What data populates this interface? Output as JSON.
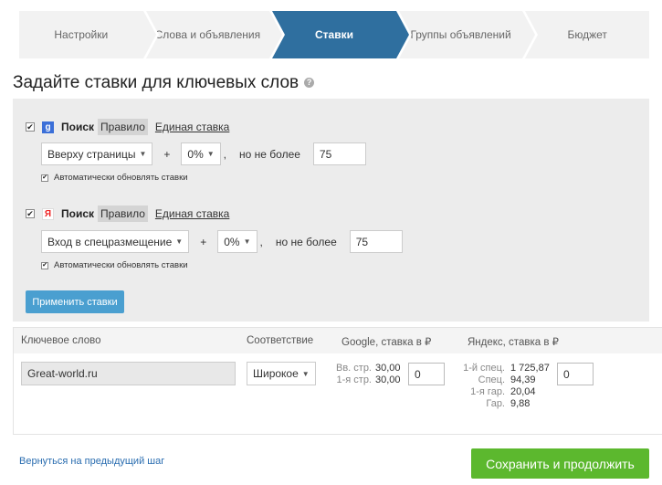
{
  "steps": [
    {
      "label": "Настройки",
      "active": false
    },
    {
      "label": "Слова и объявления",
      "active": false
    },
    {
      "label": "Ставки",
      "active": true
    },
    {
      "label": "Группы объявлений",
      "active": false
    },
    {
      "label": "Бюджет",
      "active": false
    }
  ],
  "page_title": "Задайте ставки для ключевых слов",
  "help_icon": "?",
  "google_block": {
    "logo": "g",
    "label": "Поиск",
    "tab_rule": "Правило",
    "tab_single": "Единая ставка",
    "position_select": "Вверху страницы",
    "plus": "+",
    "percent_select": "0%",
    "comma": ",",
    "max_label": "но не более",
    "max_value": "75",
    "auto_update": "Автоматически обновлять ставки"
  },
  "yandex_block": {
    "logo": "Я",
    "label": "Поиск",
    "tab_rule": "Правило",
    "tab_single": "Единая ставка",
    "position_select": "Вход в спецразмещение",
    "plus": "+",
    "percent_select": "0%",
    "comma": ",",
    "max_label": "но не более",
    "max_value": "75",
    "auto_update": "Автоматически обновлять ставки"
  },
  "apply_button": "Применить ставки",
  "table": {
    "headers": {
      "keyword": "Ключевое слово",
      "match": "Соответствие",
      "google": "Google, ставка в ₽",
      "yandex": "Яндекс, ставка в ₽"
    },
    "row": {
      "keyword": "Great-world.ru",
      "match": "Широкое",
      "google_labels": [
        "Вв. стр.",
        "1-я стр."
      ],
      "google_values": [
        "30,00",
        "30,00"
      ],
      "google_bid": "0",
      "yandex_labels": [
        "1-й спец.",
        "Спец.",
        "1-я гар.",
        "Гар."
      ],
      "yandex_values": [
        "1 725,87",
        "94,39",
        "20,04",
        "9,88"
      ],
      "yandex_bid": "0"
    }
  },
  "back_link": "Вернуться на предыдущий шаг",
  "save_button": "Сохранить и продолжить",
  "colors": {
    "active_step": "#2f6f9f",
    "apply_button": "#4a9fd0",
    "save_button": "#5cb82e",
    "link": "#2a6db0"
  }
}
